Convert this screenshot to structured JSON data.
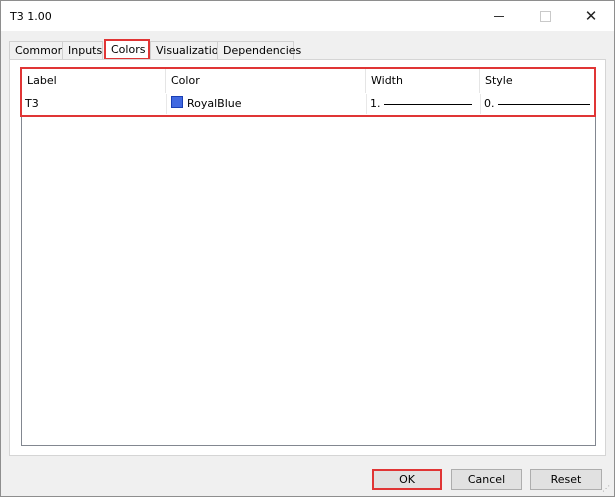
{
  "window": {
    "title": "T3 1.00"
  },
  "tabs": [
    {
      "label": "Common"
    },
    {
      "label": "Inputs"
    },
    {
      "label": "Colors"
    },
    {
      "label": "Visualization"
    },
    {
      "label": "Dependencies"
    }
  ],
  "active_tab": "Colors",
  "table": {
    "headers": [
      "Label",
      "Color",
      "Width",
      "Style"
    ],
    "rows": [
      {
        "label": "T3",
        "color_name": "RoyalBlue",
        "color_hex": "#4169E1",
        "width": "1.",
        "style": "0."
      }
    ]
  },
  "buttons": {
    "ok": "OK",
    "cancel": "Cancel",
    "reset": "Reset"
  },
  "colors": {
    "highlight": "#e03535",
    "swatch": "#4169E1"
  },
  "icons": {
    "minimize": "minimize-icon",
    "maximize": "maximize-icon",
    "close": "close-icon",
    "resize": "resize-grip-icon"
  }
}
